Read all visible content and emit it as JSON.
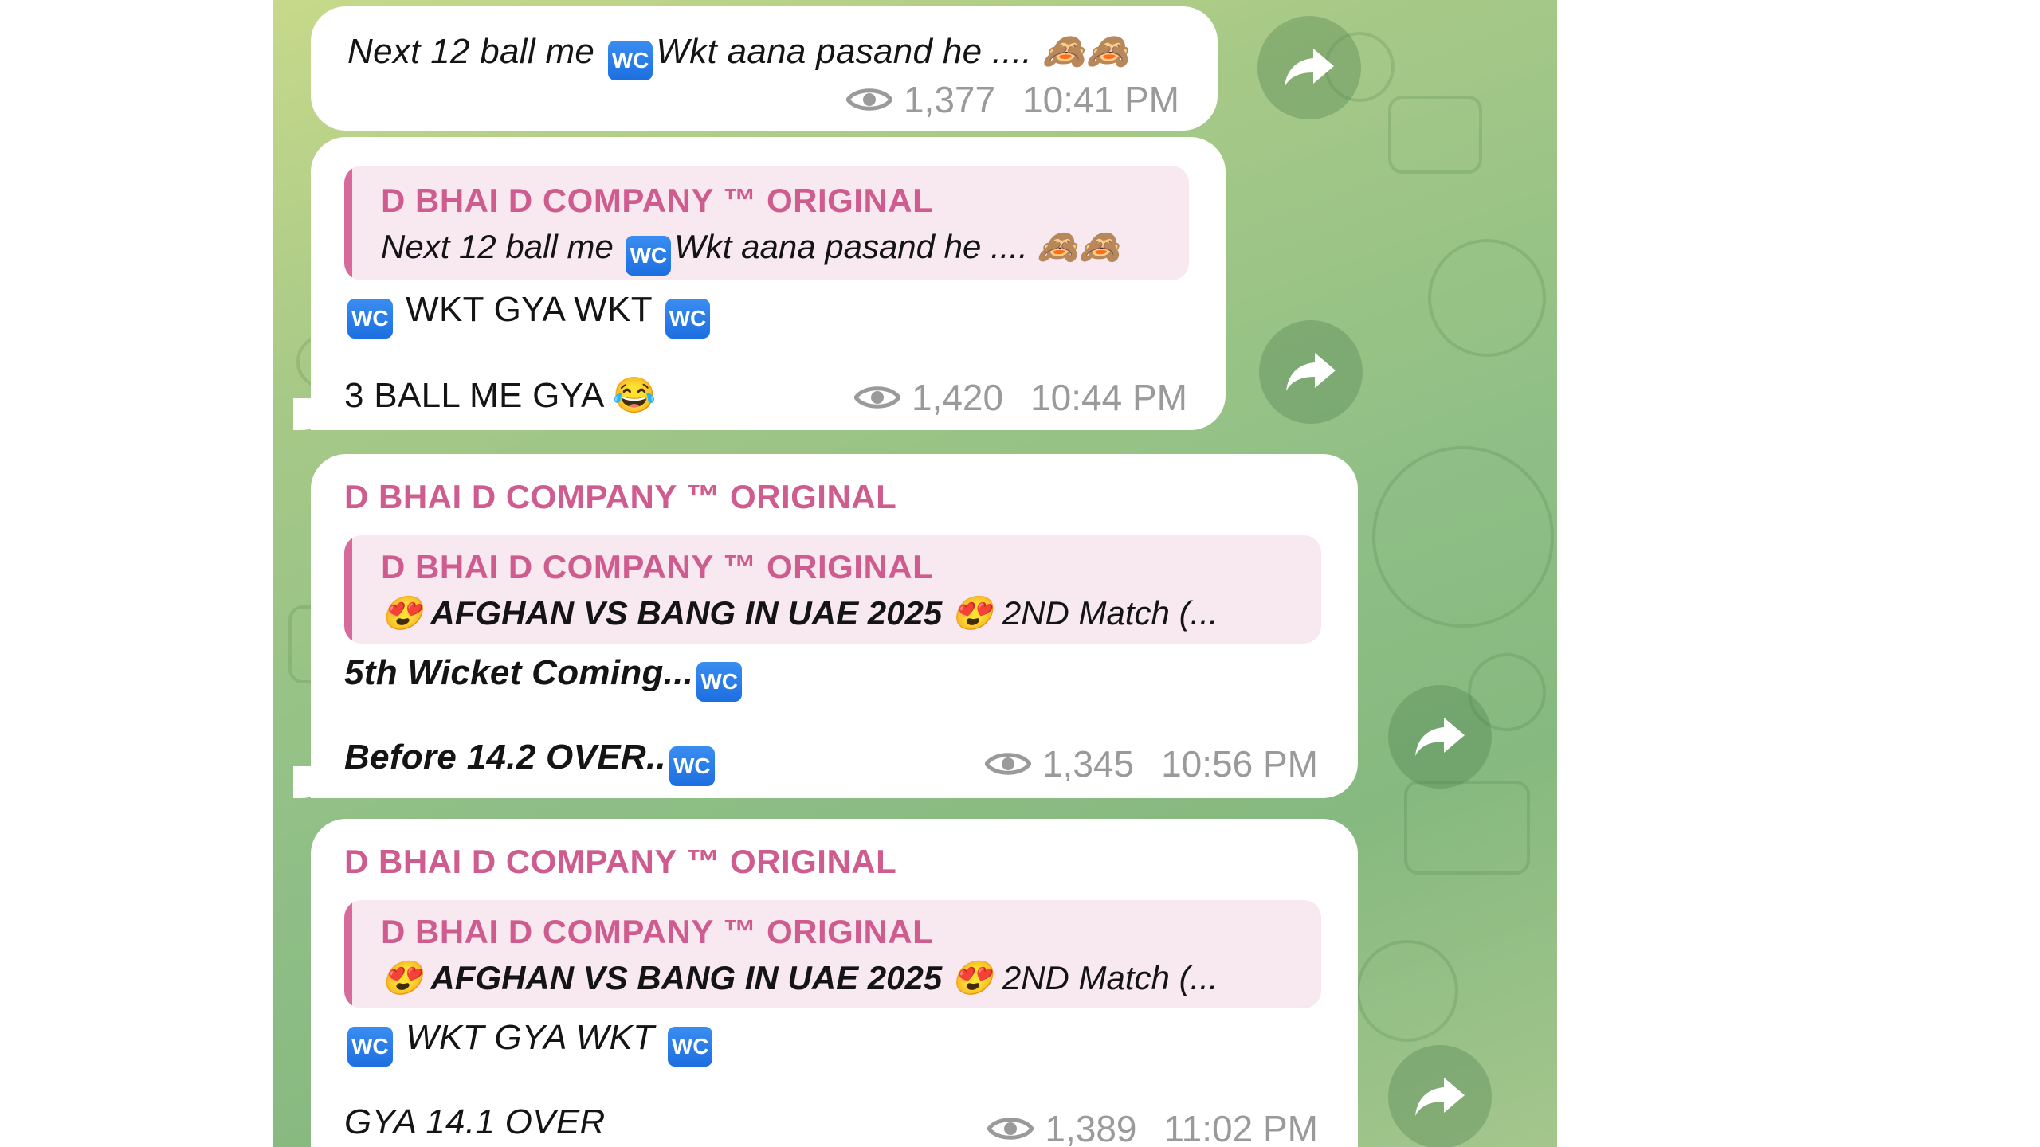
{
  "messages": [
    {
      "text_parts": [
        "Next 12 ball me ",
        "WC",
        "Wkt aana pasand he .... ",
        "🙈🙈"
      ],
      "views": "1,377",
      "time": "10:41 PM"
    },
    {
      "quote": {
        "sender": "D BHAI D COMPANY ™ ORIGINAL",
        "text_parts": [
          "Next 12 ball me ",
          "WC",
          "Wkt aana pasand he .... ",
          "🙈🙈"
        ]
      },
      "line1_parts": [
        "WC",
        " WKT GYA WKT ",
        "WC"
      ],
      "line2_parts": [
        "3 BALL ME GYA ",
        "😂"
      ],
      "views": "1,420",
      "time": "10:44 PM"
    },
    {
      "sender": "D BHAI D COMPANY ™ ORIGINAL",
      "quote": {
        "sender": "D BHAI D COMPANY ™ ORIGINAL",
        "text_parts": [
          "😍",
          " AFGHAN VS BANG IN UAE 2025 ",
          "😍",
          "  2ND Match    (..."
        ]
      },
      "line1_parts": [
        "5th Wicket Coming...",
        "WC"
      ],
      "line2_parts": [
        "Before 14.2 OVER..",
        "WC"
      ],
      "views": "1,345",
      "time": "10:56 PM"
    },
    {
      "sender": "D BHAI D COMPANY ™ ORIGINAL",
      "quote": {
        "sender": "D BHAI D COMPANY ™ ORIGINAL",
        "text_parts": [
          "😍",
          " AFGHAN VS BANG IN UAE 2025 ",
          "😍",
          "  2ND Match    (..."
        ]
      },
      "line1_parts": [
        "WC",
        " WKT GYA WKT ",
        "WC"
      ],
      "line2_parts": [
        "GYA 14.1 OVER"
      ],
      "views": "1,389",
      "time": "11:02 PM"
    }
  ],
  "icons": {
    "views": "eye-icon",
    "share": "share-forward-icon",
    "wc_badge": "wc-emoji"
  },
  "colors": {
    "sender": "#cf5c8f",
    "quote_bg": "#f8e8f0",
    "quote_bar": "#d86a9b",
    "meta": "#9a9a9a",
    "chat_bg": "#8fbf86"
  }
}
